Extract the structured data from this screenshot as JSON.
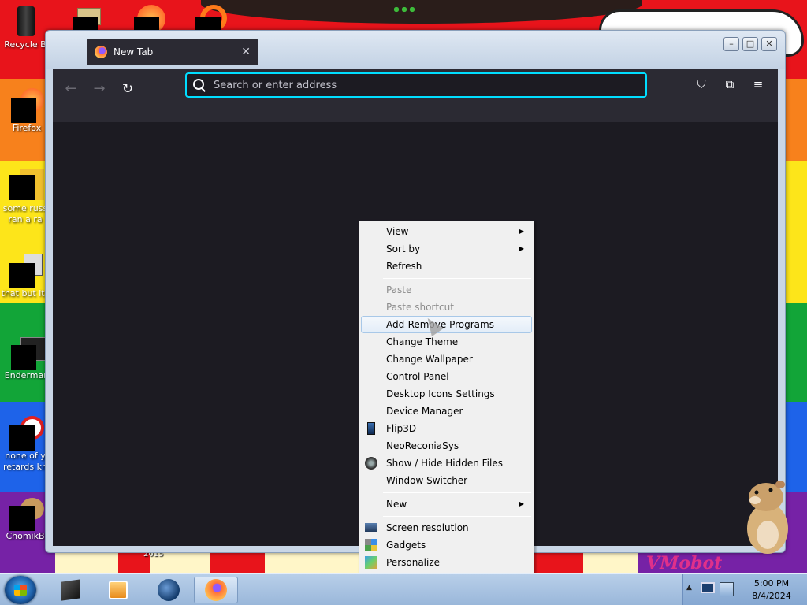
{
  "desktop": {
    "icons": [
      {
        "label": "Recycle B"
      },
      {
        "label": "Firefox"
      },
      {
        "label": "some russ"
      },
      {
        "label": "ran a ra"
      },
      {
        "label": "that but its"
      },
      {
        "label": "Enderman"
      },
      {
        "label": "none of y"
      },
      {
        "label": "retards kn"
      },
      {
        "label": "ChomikB"
      }
    ],
    "wallpaper_text_2015": "2015",
    "wallpaper_text_vmobot": "VMobot"
  },
  "browser": {
    "tab": {
      "title": "New Tab",
      "close_glyph": "✕"
    },
    "window_buttons": {
      "minimize": "–",
      "maximize": "□",
      "close": "✕"
    },
    "toolbar": {
      "back_glyph": "←",
      "forward_glyph": "→",
      "reload_glyph": "↻",
      "pocket_glyph": "⛉",
      "extensions_glyph": "⧉",
      "menu_glyph": "≡"
    },
    "urlbar": {
      "placeholder": "Search or enter address",
      "value": ""
    }
  },
  "context_menu": {
    "items": [
      {
        "label": "View",
        "submenu": "▶"
      },
      {
        "label": "Sort by",
        "submenu": "▶"
      },
      {
        "label": "Refresh"
      },
      {
        "label": "Paste"
      },
      {
        "label": "Paste shortcut"
      },
      {
        "label": "Add-Remove Programs"
      },
      {
        "label": "Change Theme"
      },
      {
        "label": "Change Wallpaper"
      },
      {
        "label": "Control Panel"
      },
      {
        "label": "Desktop Icons Settings"
      },
      {
        "label": "Device Manager"
      },
      {
        "label": "Flip3D"
      },
      {
        "label": "NeoReconiaSys"
      },
      {
        "label": "Show / Hide Hidden Files"
      },
      {
        "label": "Window Switcher"
      },
      {
        "label": "New",
        "submenu": "▶"
      },
      {
        "label": "Screen resolution"
      },
      {
        "label": "Gadgets"
      },
      {
        "label": "Personalize"
      }
    ]
  },
  "taskbar": {
    "tray_arrow": "▲",
    "clock_time": "5:00 PM",
    "clock_date": "8/4/2024"
  },
  "colors": {
    "accent_focus": "#00ddff",
    "browser_toolbar": "#2b2a33",
    "browser_content": "#1c1b22"
  }
}
